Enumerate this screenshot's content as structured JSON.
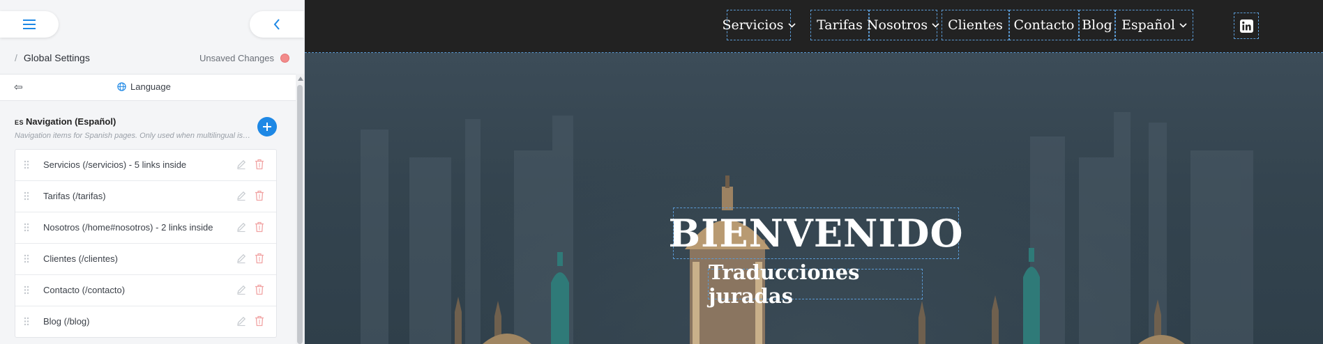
{
  "panel": {
    "menu_icon": "hamburger-icon",
    "back_icon": "chevron-left-icon",
    "breadcrumb_separator": "/",
    "breadcrumb_title": "Global Settings",
    "unsaved_label": "Unsaved Changes",
    "unsaved_color": "#f28b8b",
    "language_back_icon": "back-arrow-icon",
    "language_back_glyph": "⇦",
    "language_icon": "globe-icon",
    "language_title": "Language",
    "section_flag": "ES",
    "section_title": "Navigation (Español)",
    "section_description": "Navigation items for Spanish pages. Only used when multilingual is enabled.",
    "add_icon": "plus-icon",
    "accent_color": "#1e88e5",
    "items": [
      {
        "label": "Servicios (/servicios) - 5 links inside"
      },
      {
        "label": "Tarifas (/tarifas)"
      },
      {
        "label": "Nosotros (/home#nosotros) - 2 links inside"
      },
      {
        "label": "Clientes (/clientes)"
      },
      {
        "label": "Contacto (/contacto)"
      },
      {
        "label": "Blog (/blog)"
      }
    ]
  },
  "site": {
    "nav": [
      {
        "label": "Servicios",
        "has_dropdown": true
      },
      {
        "label": "Tarifas",
        "has_dropdown": false
      },
      {
        "label": "Nosotros",
        "has_dropdown": true
      },
      {
        "label": "Clientes",
        "has_dropdown": false
      },
      {
        "label": "Contacto",
        "has_dropdown": false
      },
      {
        "label": "Blog",
        "has_dropdown": false
      },
      {
        "label": "Español",
        "has_dropdown": true
      }
    ],
    "social_icon": "linkedin-icon",
    "hero_title": "BIENVENIDO",
    "hero_subtitle": "Traducciones juradas",
    "header_color": "#222222",
    "outline_color": "#5b9bd5"
  }
}
